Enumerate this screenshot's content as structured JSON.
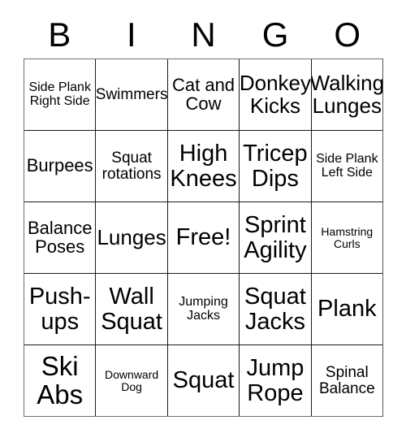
{
  "card": {
    "header_letters": [
      "B",
      "I",
      "N",
      "G",
      "O"
    ],
    "columns": 5,
    "rows": 5,
    "free_space_label": "Free!",
    "free_space_position": {
      "row": 3,
      "column": 3
    },
    "colors": {
      "background": "#ffffff",
      "text": "#000000",
      "grid_line": "#1a1a1a",
      "outer_border": "#6e6e6e"
    },
    "cells": [
      [
        {
          "text": "Side Plank Right Side",
          "size": "sm"
        },
        {
          "text": "Swimmers",
          "size": "md"
        },
        {
          "text": "Cat and Cow",
          "size": "lg"
        },
        {
          "text": "Donkey Kicks",
          "size": "xl"
        },
        {
          "text": "Walking Lunges",
          "size": "xl"
        }
      ],
      [
        {
          "text": "Burpees",
          "size": "lg"
        },
        {
          "text": "Squat rotations",
          "size": "md"
        },
        {
          "text": "High Knees",
          "size": "xxl"
        },
        {
          "text": "Tricep Dips",
          "size": "xxl"
        },
        {
          "text": "Side Plank Left Side",
          "size": "sm"
        }
      ],
      [
        {
          "text": "Balance Poses",
          "size": "lg"
        },
        {
          "text": "Lunges",
          "size": "xl"
        },
        {
          "text": "Free!",
          "size": "xxl"
        },
        {
          "text": "Sprint Agility",
          "size": "xxl"
        },
        {
          "text": "Hamstring Curls",
          "size": "xs"
        }
      ],
      [
        {
          "text": "Push-ups",
          "size": "xxl"
        },
        {
          "text": "Wall Squat",
          "size": "xxl"
        },
        {
          "text": "Jumping Jacks",
          "size": "sm"
        },
        {
          "text": "Squat Jacks",
          "size": "xxl"
        },
        {
          "text": "Plank",
          "size": "xxl"
        }
      ],
      [
        {
          "text": "Ski Abs",
          "size": "huge"
        },
        {
          "text": "Downward Dog",
          "size": "xs"
        },
        {
          "text": "Squat",
          "size": "xxl"
        },
        {
          "text": "Jump Rope",
          "size": "xxl"
        },
        {
          "text": "Spinal Balance",
          "size": "md"
        }
      ]
    ]
  }
}
